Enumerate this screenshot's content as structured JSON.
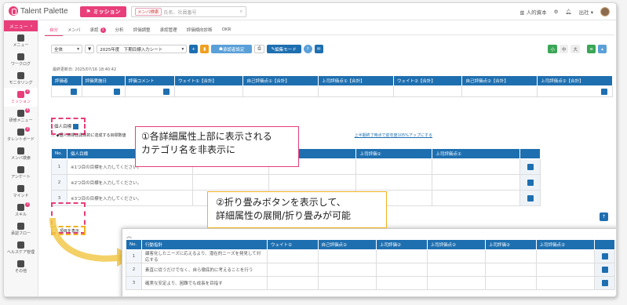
{
  "header": {
    "logo": "Talent Palette",
    "mission_button": "ミッション",
    "search_tag": "メンバ検索",
    "search_placeholder": "氏名、社員番号",
    "capital_link": "人的資本",
    "user_name": "出社"
  },
  "sidebar": {
    "menu_label": "メニュー",
    "items": [
      {
        "label": "メニュー",
        "badge": ""
      },
      {
        "label": "ワークログ",
        "badge": ""
      },
      {
        "label": "モニタリング",
        "badge": ""
      },
      {
        "label": "ミッション",
        "badge": "1"
      },
      {
        "label": "研修メニュー",
        "badge": "4"
      },
      {
        "label": "タレントボード",
        "badge": "1"
      },
      {
        "label": "メンバ検索",
        "badge": ""
      },
      {
        "label": "アンケート",
        "badge": ""
      },
      {
        "label": "マインド",
        "badge": ""
      },
      {
        "label": "スキル",
        "badge": "1"
      },
      {
        "label": "承認フロー",
        "badge": ""
      },
      {
        "label": "ヘルスケア管理",
        "badge": ""
      },
      {
        "label": "その他",
        "badge": ""
      }
    ]
  },
  "tabs": [
    {
      "label": "自分",
      "badge": ""
    },
    {
      "label": "メンバ",
      "badge": ""
    },
    {
      "label": "承認",
      "badge": "1"
    },
    {
      "label": "分析",
      "badge": ""
    },
    {
      "label": "評価調整",
      "badge": ""
    },
    {
      "label": "承認管理",
      "badge": ""
    },
    {
      "label": "評価傾向診断",
      "badge": ""
    },
    {
      "label": "OKR",
      "badge": ""
    }
  ],
  "toolbar": {
    "scope_select": "全体",
    "period_select": "2025年度　下期目標入力シート",
    "approver_button": "承認者設定",
    "edit_mode_button": "編集モード",
    "size_small": "小",
    "size_mid": "中",
    "size_large": "大"
  },
  "last_updated": "最終更新日: 2025/07/16 18:40:42",
  "eval_table": {
    "columns": [
      "評価者",
      "評価実施日",
      "評価コメント",
      "ウェイト①【合計】",
      "自己評価点①【合計】",
      "上司評価点①【合計】",
      "ウェイト②【合計】",
      "自己評価点②【合計】",
      "上司評価点②【合計】"
    ]
  },
  "category_label": "個人目標",
  "group_header": "個人目標は具体的に達成する目標数値",
  "group_link": "上半期終了時点で前年度105%アップにする",
  "goal_table": {
    "columns": [
      "No.",
      "個人目標",
      "ウェイト①",
      "自己評価点①",
      "上司評価①",
      "上司評価点①"
    ],
    "rows": [
      {
        "no": "1",
        "text": "※1つ目の目標を入力してください。"
      },
      {
        "no": "2",
        "text": "※2つ目の目標を入力してください。"
      },
      {
        "no": "3",
        "text": "※3つ目の目標を入力してください。"
      }
    ]
  },
  "show_items_toggle": "項目を表示",
  "callout1": {
    "line1": "①各詳細属性上部に表示される",
    "line2": "カテゴリ名を非表示に"
  },
  "callout2": {
    "line1": "②折り畳みボタンを表示して、",
    "line2": "詳細属性の展開/折り畳みが可能"
  },
  "action_table": {
    "columns": [
      "No.",
      "行動指針",
      "ウェイト②",
      "自己評価点②",
      "上司評価②",
      "上司評価点②",
      "上司評価②",
      "上司評価点②"
    ],
    "rows": [
      {
        "no": "1",
        "text": "顧客化したニーズに応えるより、潜在的ニーズを発見して対応する"
      },
      {
        "no": "2",
        "text": "素直に従うだけでなく、自ら徹底的に考えることを行う"
      },
      {
        "no": "3",
        "text": "確実な安定より、困難でも成長を目指す"
      }
    ]
  },
  "colors": {
    "brand": "#e83e7a",
    "table_header": "#1e6fb0",
    "callout2_border": "#f2b01e"
  }
}
